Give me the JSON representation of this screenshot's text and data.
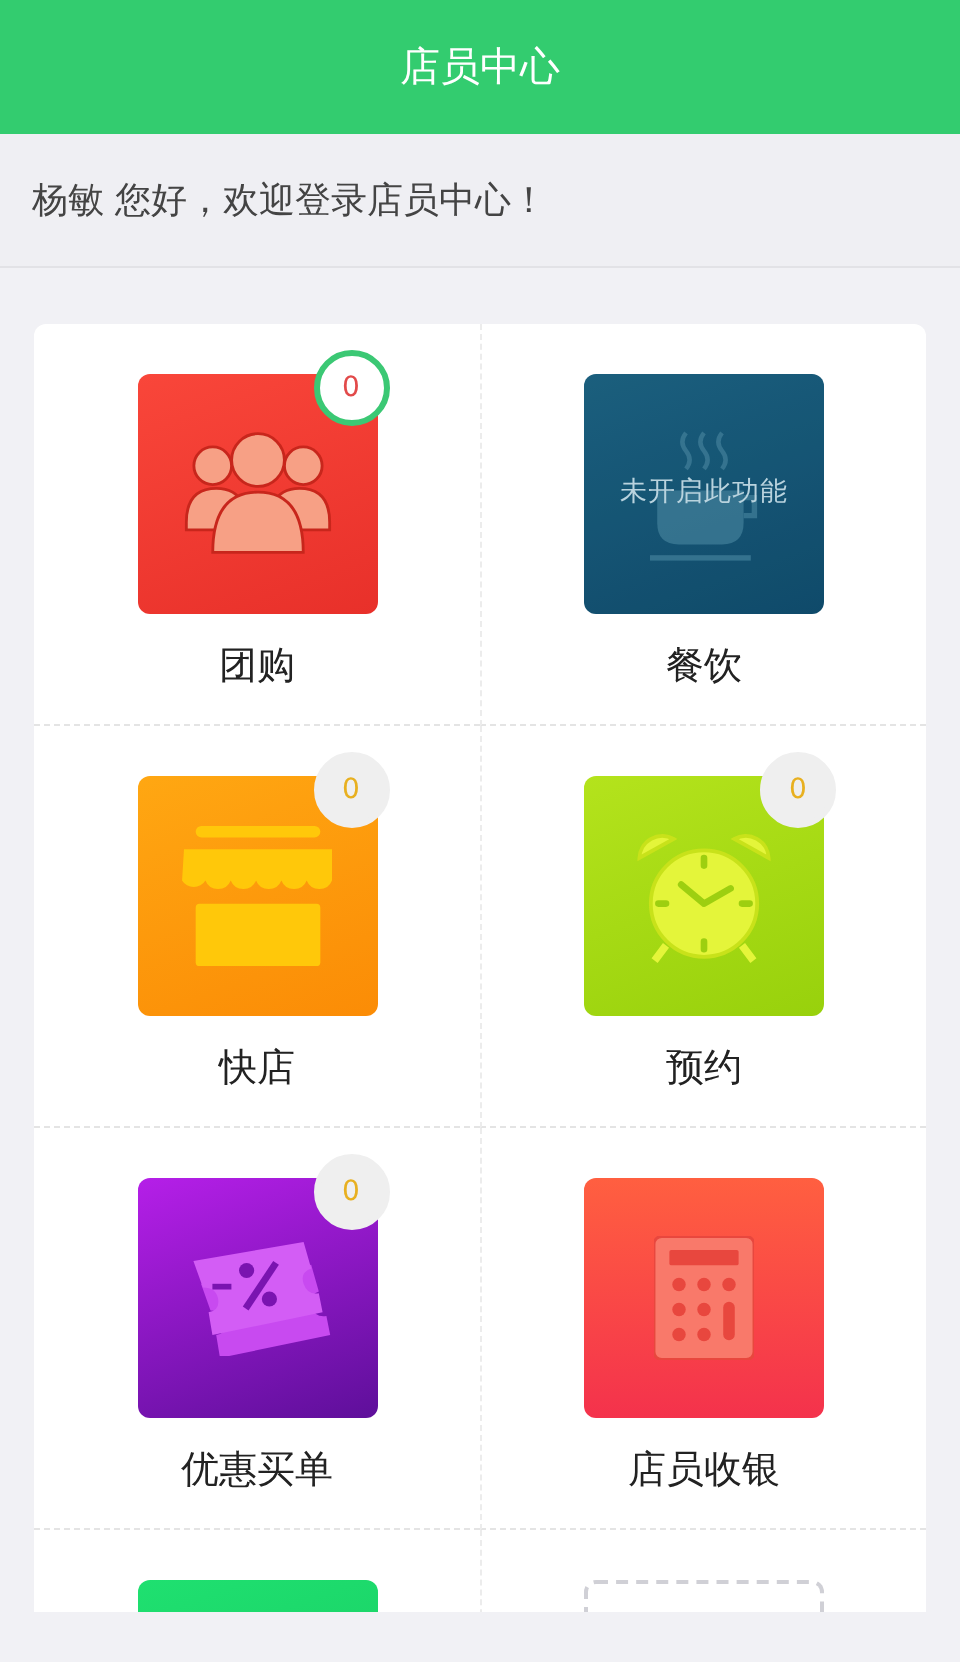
{
  "header": {
    "title": "店员中心"
  },
  "greeting": "杨敏 您好，欢迎登录店员中心！",
  "tiles": [
    {
      "kind": "group",
      "label": "团购",
      "badge": "0",
      "badge_active": true,
      "disabled": false
    },
    {
      "kind": "dining",
      "label": "餐饮",
      "overlay": "未开启此功能",
      "disabled": true
    },
    {
      "kind": "shop",
      "label": "快店",
      "badge": "0",
      "badge_active": false,
      "disabled": false
    },
    {
      "kind": "alarm",
      "label": "预约",
      "badge": "0",
      "badge_active": false,
      "disabled": false
    },
    {
      "kind": "coupon",
      "label": "优惠买单",
      "badge": "0",
      "badge_active": false,
      "disabled": false
    },
    {
      "kind": "calculator",
      "label": "店员收银",
      "disabled": false
    },
    {
      "kind": "green",
      "disabled": false
    },
    {
      "kind": "empty",
      "disabled": false
    }
  ]
}
